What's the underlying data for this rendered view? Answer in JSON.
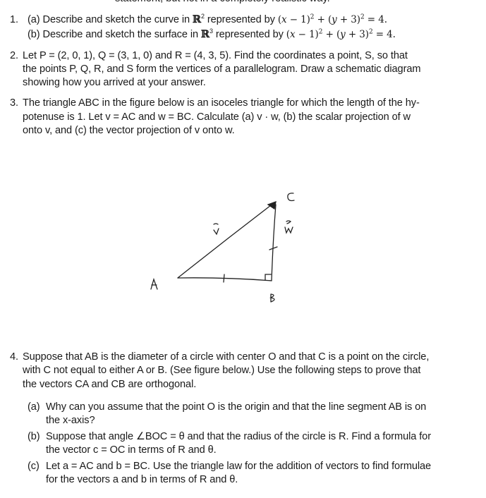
{
  "clipped_top_line": "statement, but not in a completely realistic way.",
  "problems": [
    {
      "number": "1.",
      "parts": [
        {
          "label": "(a)",
          "text_before": "Describe and sketch the curve in ",
          "space": "ℝ",
          "dim": "2",
          "text_mid": " represented by ",
          "equation": "(x − 1)² + (y + 3)² = 4."
        },
        {
          "label": "(b)",
          "text_before": "Describe and sketch the surface in ",
          "space": "ℝ",
          "dim": "3",
          "text_mid": " represented by ",
          "equation": "(x − 1)² + (y + 3)² = 4."
        }
      ]
    },
    {
      "number": "2.",
      "lines": [
        "Let P = (2, 0, 1), Q = (3, 1, 0) and R = (4, 3, 5).  Find the coordinates a point, S, so that",
        "the points P, Q, R, and S form the vertices of a parallelogram. Draw a schematic diagram",
        "showing how you arrived at your answer."
      ]
    },
    {
      "number": "3.",
      "lines": [
        "The triangle ABC in the figure below is an isoceles triangle for which the length of the hy-",
        "potenuse is 1.  Let v = AC and w = BC.  Calculate (a) v · w, (b) the scalar projection of w",
        "onto v, and (c) the vector projection of v onto w."
      ],
      "figure": {
        "labels": {
          "A": "A",
          "B": "B",
          "C": "C",
          "v": "v",
          "w": "w"
        }
      }
    },
    {
      "number": "4.",
      "lines": [
        "Suppose that AB is the diameter of a circle with center O and that C is a point on the circle,",
        "with C not equal to either A or B.  (See figure below.)  Use the following steps to prove that",
        "the vectors CA and CB are orthogonal."
      ],
      "parts": [
        {
          "label": "(a)",
          "lines": [
            "Why can you assume that the point O is the origin and that the line segment AB is on",
            "the x-axis?"
          ]
        },
        {
          "label": "(b)",
          "lines": [
            "Suppose that angle ∠BOC = θ and that the radius of the circle is R. Find a formula for",
            "the vector c = OC in terms of R and θ."
          ]
        },
        {
          "label": "(c)",
          "lines": [
            "Let a = AC and b = BC. Use the triangle law for the addition of vectors to find formulae",
            "for the vectors a and b in terms of R and θ."
          ]
        }
      ]
    }
  ]
}
